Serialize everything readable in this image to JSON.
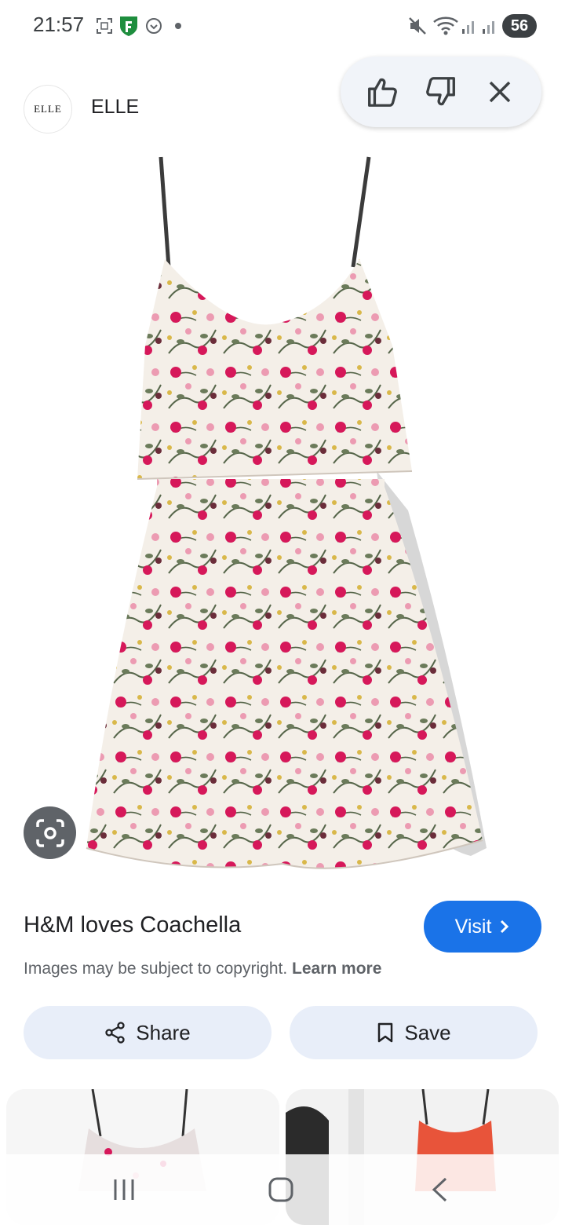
{
  "status_bar": {
    "time": "21:57",
    "battery": "56",
    "icons": [
      "screenshot-icon",
      "shield-app-icon",
      "sync-icon",
      "dot-icon",
      "mute-icon",
      "wifi-icon",
      "signal-icon",
      "signal-icon"
    ]
  },
  "publisher": {
    "logo_text": "ELLE",
    "name": "ELLE"
  },
  "feedback": {
    "icons": [
      "thumbs-up-icon",
      "thumbs-down-icon",
      "close-icon"
    ]
  },
  "image": {
    "subject": "floral-print-dress",
    "colors": {
      "base": "#f4efe8",
      "flower_red": "#d6185a",
      "flower_pink": "#ec9bb2",
      "leaf": "#56664a",
      "yellow": "#d9b84a"
    }
  },
  "result": {
    "title": "H&M loves Coachella",
    "visit_label": "Visit",
    "copyright_text": "Images may be subject to copyright.",
    "learn_more": "Learn more"
  },
  "actions": {
    "share_label": "Share",
    "save_label": "Save"
  },
  "colors": {
    "accent": "#1a73e8",
    "pill_bg": "#e8eef9"
  },
  "nav": {
    "icons": [
      "recents-icon",
      "home-icon",
      "back-icon"
    ]
  }
}
